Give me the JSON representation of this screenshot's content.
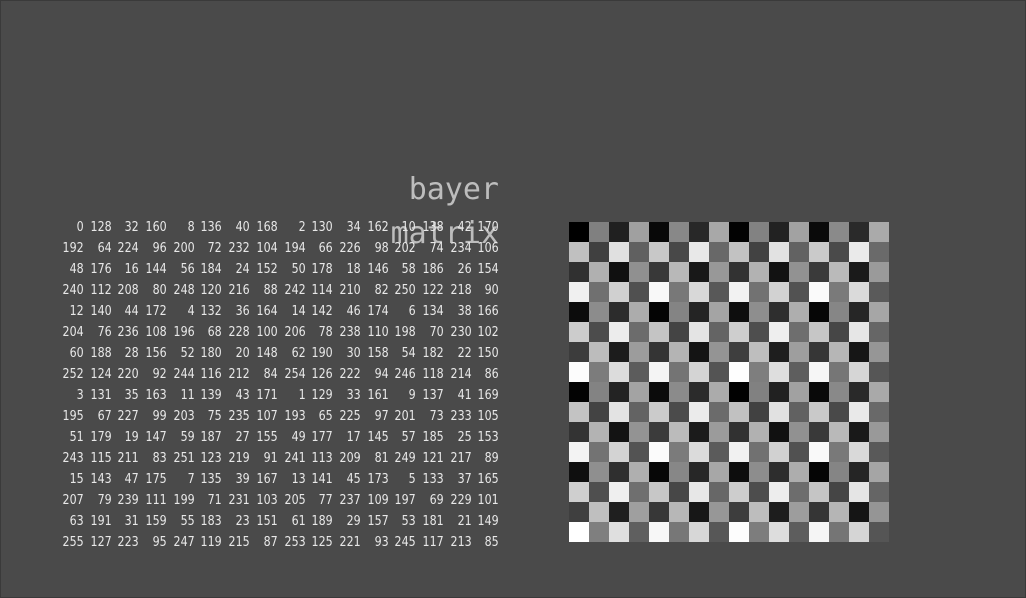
{
  "title": "bayer matrix",
  "matrix": [
    [
      0,
      128,
      32,
      160,
      8,
      136,
      40,
      168,
      2,
      130,
      34,
      162,
      10,
      138,
      42,
      170
    ],
    [
      192,
      64,
      224,
      96,
      200,
      72,
      232,
      104,
      194,
      66,
      226,
      98,
      202,
      74,
      234,
      106
    ],
    [
      48,
      176,
      16,
      144,
      56,
      184,
      24,
      152,
      50,
      178,
      18,
      146,
      58,
      186,
      26,
      154
    ],
    [
      240,
      112,
      208,
      80,
      248,
      120,
      216,
      88,
      242,
      114,
      210,
      82,
      250,
      122,
      218,
      90
    ],
    [
      12,
      140,
      44,
      172,
      4,
      132,
      36,
      164,
      14,
      142,
      46,
      174,
      6,
      134,
      38,
      166
    ],
    [
      204,
      76,
      236,
      108,
      196,
      68,
      228,
      100,
      206,
      78,
      238,
      110,
      198,
      70,
      230,
      102
    ],
    [
      60,
      188,
      28,
      156,
      52,
      180,
      20,
      148,
      62,
      190,
      30,
      158,
      54,
      182,
      22,
      150
    ],
    [
      252,
      124,
      220,
      92,
      244,
      116,
      212,
      84,
      254,
      126,
      222,
      94,
      246,
      118,
      214,
      86
    ],
    [
      3,
      131,
      35,
      163,
      11,
      139,
      43,
      171,
      1,
      129,
      33,
      161,
      9,
      137,
      41,
      169
    ],
    [
      195,
      67,
      227,
      99,
      203,
      75,
      235,
      107,
      193,
      65,
      225,
      97,
      201,
      73,
      233,
      105
    ],
    [
      51,
      179,
      19,
      147,
      59,
      187,
      27,
      155,
      49,
      177,
      17,
      145,
      57,
      185,
      25,
      153
    ],
    [
      243,
      115,
      211,
      83,
      251,
      123,
      219,
      91,
      241,
      113,
      209,
      81,
      249,
      121,
      217,
      89
    ],
    [
      15,
      143,
      47,
      175,
      7,
      135,
      39,
      167,
      13,
      141,
      45,
      173,
      5,
      133,
      37,
      165
    ],
    [
      207,
      79,
      239,
      111,
      199,
      71,
      231,
      103,
      205,
      77,
      237,
      109,
      197,
      69,
      229,
      101
    ],
    [
      63,
      191,
      31,
      159,
      55,
      183,
      23,
      151,
      61,
      189,
      29,
      157,
      53,
      181,
      21,
      149
    ],
    [
      255,
      127,
      223,
      95,
      247,
      119,
      215,
      87,
      253,
      125,
      221,
      93,
      245,
      117,
      213,
      85
    ]
  ],
  "colors": {
    "background": "#4a4a4a",
    "title": "#bdbdbd",
    "numbers": "#e8e8e8"
  }
}
